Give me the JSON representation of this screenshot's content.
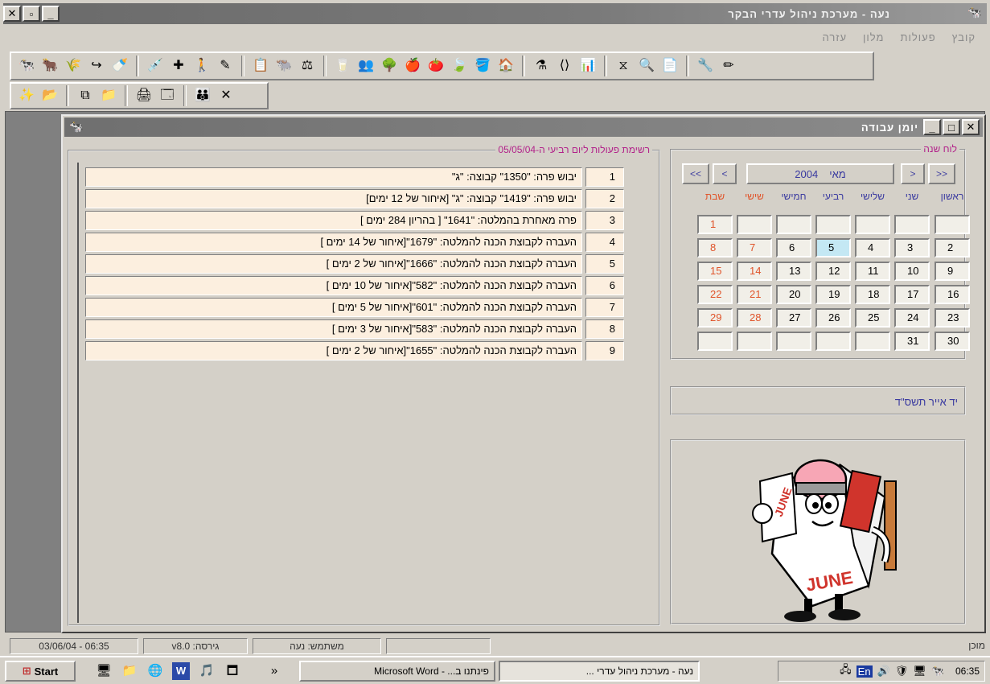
{
  "window": {
    "title": "נעה - מערכת ניהול עדרי הבקר",
    "buttons": {
      "minimize": "_",
      "maximize": "▫",
      "close": "✕"
    }
  },
  "menu": [
    "קובץ",
    "פעולות",
    "מלון",
    "עזרה"
  ],
  "toolbar1_icons": [
    "cow-icon",
    "cow-red-icon",
    "cow-feed-icon",
    "arrow-icon",
    "bottle-icon",
    "syringe-icon",
    "injection-icon",
    "person-icon",
    "pen-icon",
    "notes-icon",
    "herd-icon",
    "scale-icon",
    "milk-icon",
    "group-icon",
    "tree-icon",
    "apple-icon",
    "fruit-icon",
    "leaf-icon",
    "bucket-icon",
    "barn-icon",
    "lab-icon",
    "code-icon",
    "chart-icon",
    "filter-icon",
    "search-icon",
    "document-icon",
    "tools-icon",
    "edit-icon"
  ],
  "toolbar2_icons": [
    "wizard-icon",
    "open-folder-icon",
    "copy-icon",
    "folder-icon",
    "print-icon",
    "preview-icon",
    "users-icon",
    "close-icon"
  ],
  "child_window": {
    "title": "יומן עבודה",
    "buttons": {
      "minimize": "_",
      "maximize": "□",
      "close": "✕"
    }
  },
  "tasks": {
    "caption": "רשימת פעולות ליום רביעי ה-05/05/04",
    "items": [
      {
        "num": "1",
        "text": "יבוש פרה: \"1350\" קבוצה: \"ג\""
      },
      {
        "num": "2",
        "text": "יבוש פרה: \"1419\" קבוצה: \"ג\" [איחור של 12 ימים]"
      },
      {
        "num": "3",
        "text": "פרה מאחרת בהמלטה: \"1641\" [ בהריון 284 ימים ]"
      },
      {
        "num": "4",
        "text": "העברה לקבוצת הכנה להמלטה: \"1679\"[איחור של 14 ימים ]"
      },
      {
        "num": "5",
        "text": "העברה לקבוצת הכנה להמלטה: \"1666\"[איחור של 2 ימים ]"
      },
      {
        "num": "6",
        "text": "העברה לקבוצת הכנה להמלטה: \"582\"[איחור של 10 ימים ]"
      },
      {
        "num": "7",
        "text": "העברה לקבוצת הכנה להמלטה: \"601\"[איחור של 5 ימים ]"
      },
      {
        "num": "8",
        "text": "העברה לקבוצת הכנה להמלטה: \"583\"[איחור של 3 ימים ]"
      },
      {
        "num": "9",
        "text": "העברה לקבוצת הכנה להמלטה: \"1655\"[איחור של 2 ימים ]"
      }
    ]
  },
  "calendar": {
    "caption": "לוח שנה",
    "nav": {
      "prev_year": "<<",
      "prev_month": "<",
      "next_month": ">",
      "next_year": ">>"
    },
    "month": "מאי",
    "year": "2004",
    "weekdays": [
      "ראשון",
      "שני",
      "שלישי",
      "רביעי",
      "חמישי",
      "שישי",
      "שבת"
    ],
    "weeks": [
      [
        "",
        "",
        "",
        "",
        "",
        "",
        "1"
      ],
      [
        "2",
        "3",
        "4",
        "5",
        "6",
        "7",
        "8"
      ],
      [
        "9",
        "10",
        "11",
        "12",
        "13",
        "14",
        "15"
      ],
      [
        "16",
        "17",
        "18",
        "19",
        "20",
        "21",
        "22"
      ],
      [
        "23",
        "24",
        "25",
        "26",
        "27",
        "28",
        "29"
      ],
      [
        "30",
        "31",
        "",
        "",
        "",
        "",
        ""
      ]
    ],
    "today": "5",
    "weekend_color": "#e0542a",
    "header_color": "#3a3aa0",
    "today_color": "#c4e8f4"
  },
  "hebrew_date": "יד אייר תשס\"ד",
  "clipart_text": "JUNE",
  "status": {
    "datetime": "03/06/04 - 06:35",
    "version": "גירסה: v8.0",
    "user": "משתמש: נעה",
    "empty": "",
    "right": "מוכן"
  },
  "taskbar": {
    "start": "Start",
    "quicklaunch": [
      "desktop-icon",
      "folder-icon",
      "ie-icon",
      "word-icon",
      "media-icon",
      "window-icon"
    ],
    "more": "»",
    "buttons": [
      {
        "label": "פינתנו ב... - Microsoft Word",
        "active": false
      },
      {
        "label": "נעה - מערכת ניהול עדרי ...",
        "active": true
      }
    ],
    "clock": "06:35",
    "lang": "En"
  }
}
